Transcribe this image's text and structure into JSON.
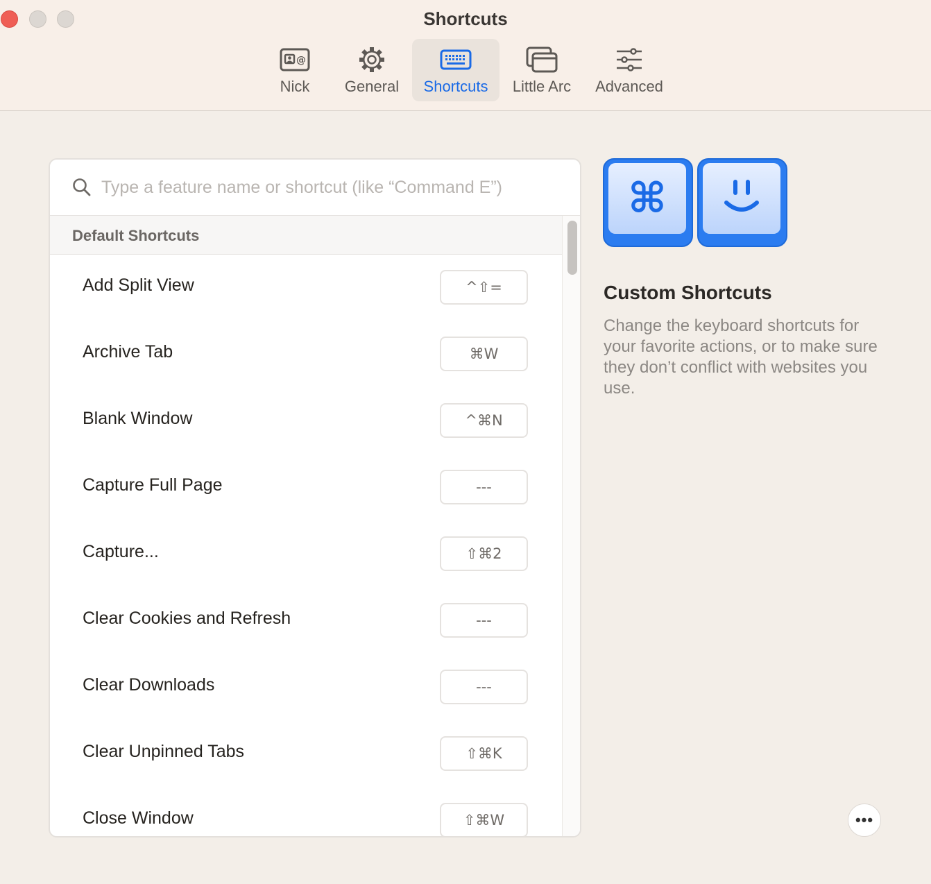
{
  "window": {
    "title": "Shortcuts"
  },
  "tabs": [
    {
      "label": "Nick",
      "icon": "contact-card-icon",
      "active": false
    },
    {
      "label": "General",
      "icon": "gear-icon",
      "active": false
    },
    {
      "label": "Shortcuts",
      "icon": "keyboard-icon",
      "active": true
    },
    {
      "label": "Little Arc",
      "icon": "windows-icon",
      "active": false
    },
    {
      "label": "Advanced",
      "icon": "sliders-icon",
      "active": false
    }
  ],
  "search": {
    "placeholder": "Type a feature name or shortcut (like “Command E”)",
    "value": ""
  },
  "list": {
    "section_header": "Default Shortcuts",
    "rows": [
      {
        "label": "Add Split View",
        "shortcut": "^⇧="
      },
      {
        "label": "Archive Tab",
        "shortcut": "⌘W"
      },
      {
        "label": "Blank Window",
        "shortcut": "^⌘N"
      },
      {
        "label": "Capture Full Page",
        "shortcut": "---"
      },
      {
        "label": "Capture...",
        "shortcut": "⇧⌘2"
      },
      {
        "label": "Clear Cookies and Refresh",
        "shortcut": "---"
      },
      {
        "label": "Clear Downloads",
        "shortcut": "---"
      },
      {
        "label": "Clear Unpinned Tabs",
        "shortcut": "⇧⌘K"
      },
      {
        "label": "Close Window",
        "shortcut": "⇧⌘W"
      }
    ]
  },
  "side": {
    "hero_keys": [
      {
        "glyph": "⌘",
        "icon": "command-key-icon"
      },
      {
        "glyph": "",
        "icon": "smiley-key-icon"
      }
    ],
    "title": "Custom Shortcuts",
    "description": "Change the keyboard shortcuts for your favorite actions, or to make sure they don’t conflict with websites you use."
  },
  "more_button": {
    "label": "•••"
  },
  "colors": {
    "accent": "#1a6ae6",
    "titlebar": "#f8efe8",
    "background": "#f3eee8",
    "close": "#ef5e55"
  }
}
